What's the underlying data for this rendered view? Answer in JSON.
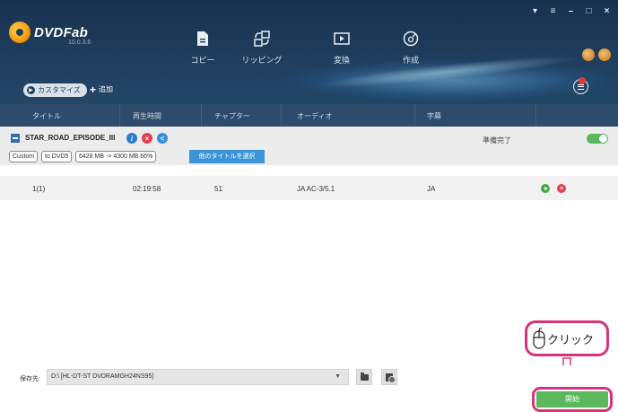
{
  "app": {
    "name": "DVDFab",
    "version": "10.0.3.6"
  },
  "window_controls": [
    "▾",
    "≡",
    "–",
    "□",
    "×"
  ],
  "modes": [
    {
      "label": "コピー",
      "icon": "copy-icon"
    },
    {
      "label": "リッピング",
      "icon": "ripper-icon"
    },
    {
      "label": "変換",
      "icon": "converter-icon"
    },
    {
      "label": "作成",
      "icon": "creator-icon"
    }
  ],
  "toolbar": {
    "customize_label": "カスタマイズ",
    "add_label": "追加"
  },
  "notification_count": "1",
  "columns": [
    "タイトル",
    "再生時間",
    "チャプター",
    "オーディオ",
    "字幕"
  ],
  "source": {
    "title": "STAR_ROAD_EPISODE_III",
    "status": "準備完了",
    "tags": [
      "Custom",
      "to DVD5",
      "6428 MB -> 4300 MB 66%"
    ],
    "other_title_button": "他のタイトルを選択"
  },
  "titles": [
    {
      "title": "1(1)",
      "duration": "02:19:58",
      "chapters": "51",
      "audio": "JA AC-3/5.1",
      "subtitle": "JA"
    }
  ],
  "output": {
    "save_to_label": "保存先:",
    "destination": "D:\\ [HL-DT-ST DVDRAMGH24NS95]",
    "start_button": "開始"
  },
  "annotation": {
    "click_label": "クリック"
  },
  "colors": {
    "header_bg": "#1f3d5c",
    "accent_blue": "#3a94d6",
    "start_green": "#5cb85c",
    "highlight_pink": "#d6337a"
  }
}
